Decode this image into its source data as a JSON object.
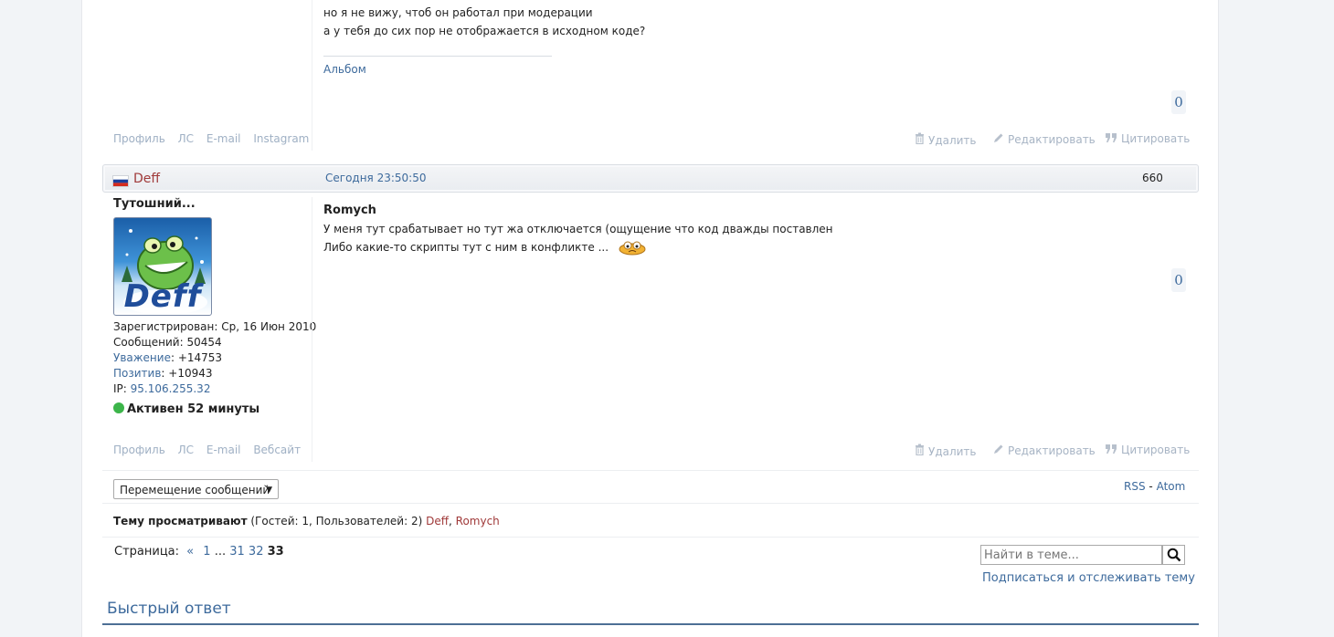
{
  "post1": {
    "lines": [
      "но я не вижу, чтоб он работал при модерации",
      "а у тебя до сих пор не отображается в исходном коде?"
    ],
    "signature_link": "Альбом",
    "likes": "0",
    "profile_links": [
      "Профиль",
      "ЛС",
      "E-mail",
      "Instagram"
    ],
    "actions": {
      "delete": "Удалить",
      "edit": "Редактировать",
      "quote": "Цитировать"
    }
  },
  "post2": {
    "author": "Deff",
    "time": "Сегодня 23:50:50",
    "number": "660",
    "rank": "Тутошний...",
    "avatar_text": "Deff",
    "registered_label": "Зарегистрирован:",
    "registered_value": "Ср, 16 Июн 2010",
    "messages_label": "Сообщений:",
    "messages_value": "50454",
    "respect_label": "Уважение",
    "respect_value": ": +14753",
    "positive_label": "Позитив",
    "positive_value": ": +10943",
    "ip_label": "IP:",
    "ip_value": "95.106.255.32",
    "status": "Активен 52 минуты",
    "status_color": "#3cb54a",
    "quote_author": "Romych",
    "lines": [
      "У меня тут срабатывает но тут жа отключается (ощущение что код дважды поставлен",
      "Либо какие-то скрипты тут с ним в конфликте ..."
    ],
    "likes": "0",
    "profile_links": [
      "Профиль",
      "ЛС",
      "E-mail",
      "Вебсайт"
    ],
    "actions": {
      "delete": "Удалить",
      "edit": "Редактировать",
      "quote": "Цитировать"
    }
  },
  "footer": {
    "move_select": "Перемещение сообщений",
    "rss": "RSS",
    "dash": "-",
    "atom": "Atom",
    "viewers_label": "Тему просматривают",
    "viewers_counts": "(Гостей: 1, Пользователей: 2)",
    "viewers_users": [
      "Deff",
      "Romych"
    ],
    "pages_label": "Страница:",
    "pages_prev": "«",
    "pages": [
      "1",
      "...",
      "31",
      "32",
      "33"
    ],
    "search_placeholder": "Найти в теме...",
    "subscribe": "Подписаться и отслеживать тему",
    "quick_reply": "Быстрый ответ"
  },
  "colors": {
    "accent": "#3d6a9c",
    "username": "#a03a3a",
    "muted": "#9fb0c4"
  }
}
